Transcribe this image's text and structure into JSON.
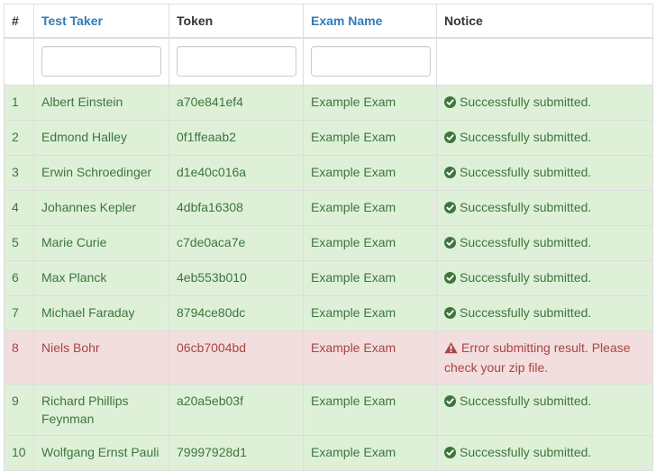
{
  "header": {
    "num": "#",
    "test_taker": "Test Taker",
    "token": "Token",
    "exam_name": "Exam Name",
    "notice": "Notice"
  },
  "filters": {
    "test_taker": "",
    "token": "",
    "exam_name": ""
  },
  "colors": {
    "success_bg": "#dff0d8",
    "success_text": "#3c763d",
    "danger_bg": "#f2dede",
    "danger_text": "#a94442",
    "link": "#337ab7"
  },
  "rows": [
    {
      "num": "1",
      "name": "Albert Einstein",
      "token": "a70e841ef4",
      "exam": "Example Exam",
      "status": "success",
      "icon": "ok-circle-icon",
      "notice": "Successfully submitted."
    },
    {
      "num": "2",
      "name": "Edmond Halley",
      "token": "0f1ffeaab2",
      "exam": "Example Exam",
      "status": "success",
      "icon": "ok-circle-icon",
      "notice": "Successfully submitted."
    },
    {
      "num": "3",
      "name": "Erwin Schroedinger",
      "token": "d1e40c016a",
      "exam": "Example Exam",
      "status": "success",
      "icon": "ok-circle-icon",
      "notice": "Successfully submitted."
    },
    {
      "num": "4",
      "name": "Johannes Kepler",
      "token": "4dbfa16308",
      "exam": "Example Exam",
      "status": "success",
      "icon": "ok-circle-icon",
      "notice": "Successfully submitted."
    },
    {
      "num": "5",
      "name": "Marie Curie",
      "token": "c7de0aca7e",
      "exam": "Example Exam",
      "status": "success",
      "icon": "ok-circle-icon",
      "notice": "Successfully submitted."
    },
    {
      "num": "6",
      "name": "Max Planck",
      "token": "4eb553b010",
      "exam": "Example Exam",
      "status": "success",
      "icon": "ok-circle-icon",
      "notice": "Successfully submitted."
    },
    {
      "num": "7",
      "name": "Michael Faraday",
      "token": "8794ce80dc",
      "exam": "Example Exam",
      "status": "success",
      "icon": "ok-circle-icon",
      "notice": "Successfully submitted."
    },
    {
      "num": "8",
      "name": "Niels Bohr",
      "token": "06cb7004bd",
      "exam": "Example Exam",
      "status": "danger",
      "icon": "warning-sign-icon",
      "notice": "Error submitting result. Please check your zip file."
    },
    {
      "num": "9",
      "name": "Richard Phillips Feynman",
      "token": "a20a5eb03f",
      "exam": "Example Exam",
      "status": "success",
      "icon": "ok-circle-icon",
      "notice": "Successfully submitted."
    },
    {
      "num": "10",
      "name": "Wolfgang Ernst Pauli",
      "token": "79997928d1",
      "exam": "Example Exam",
      "status": "success",
      "icon": "ok-circle-icon",
      "notice": "Successfully submitted."
    }
  ]
}
